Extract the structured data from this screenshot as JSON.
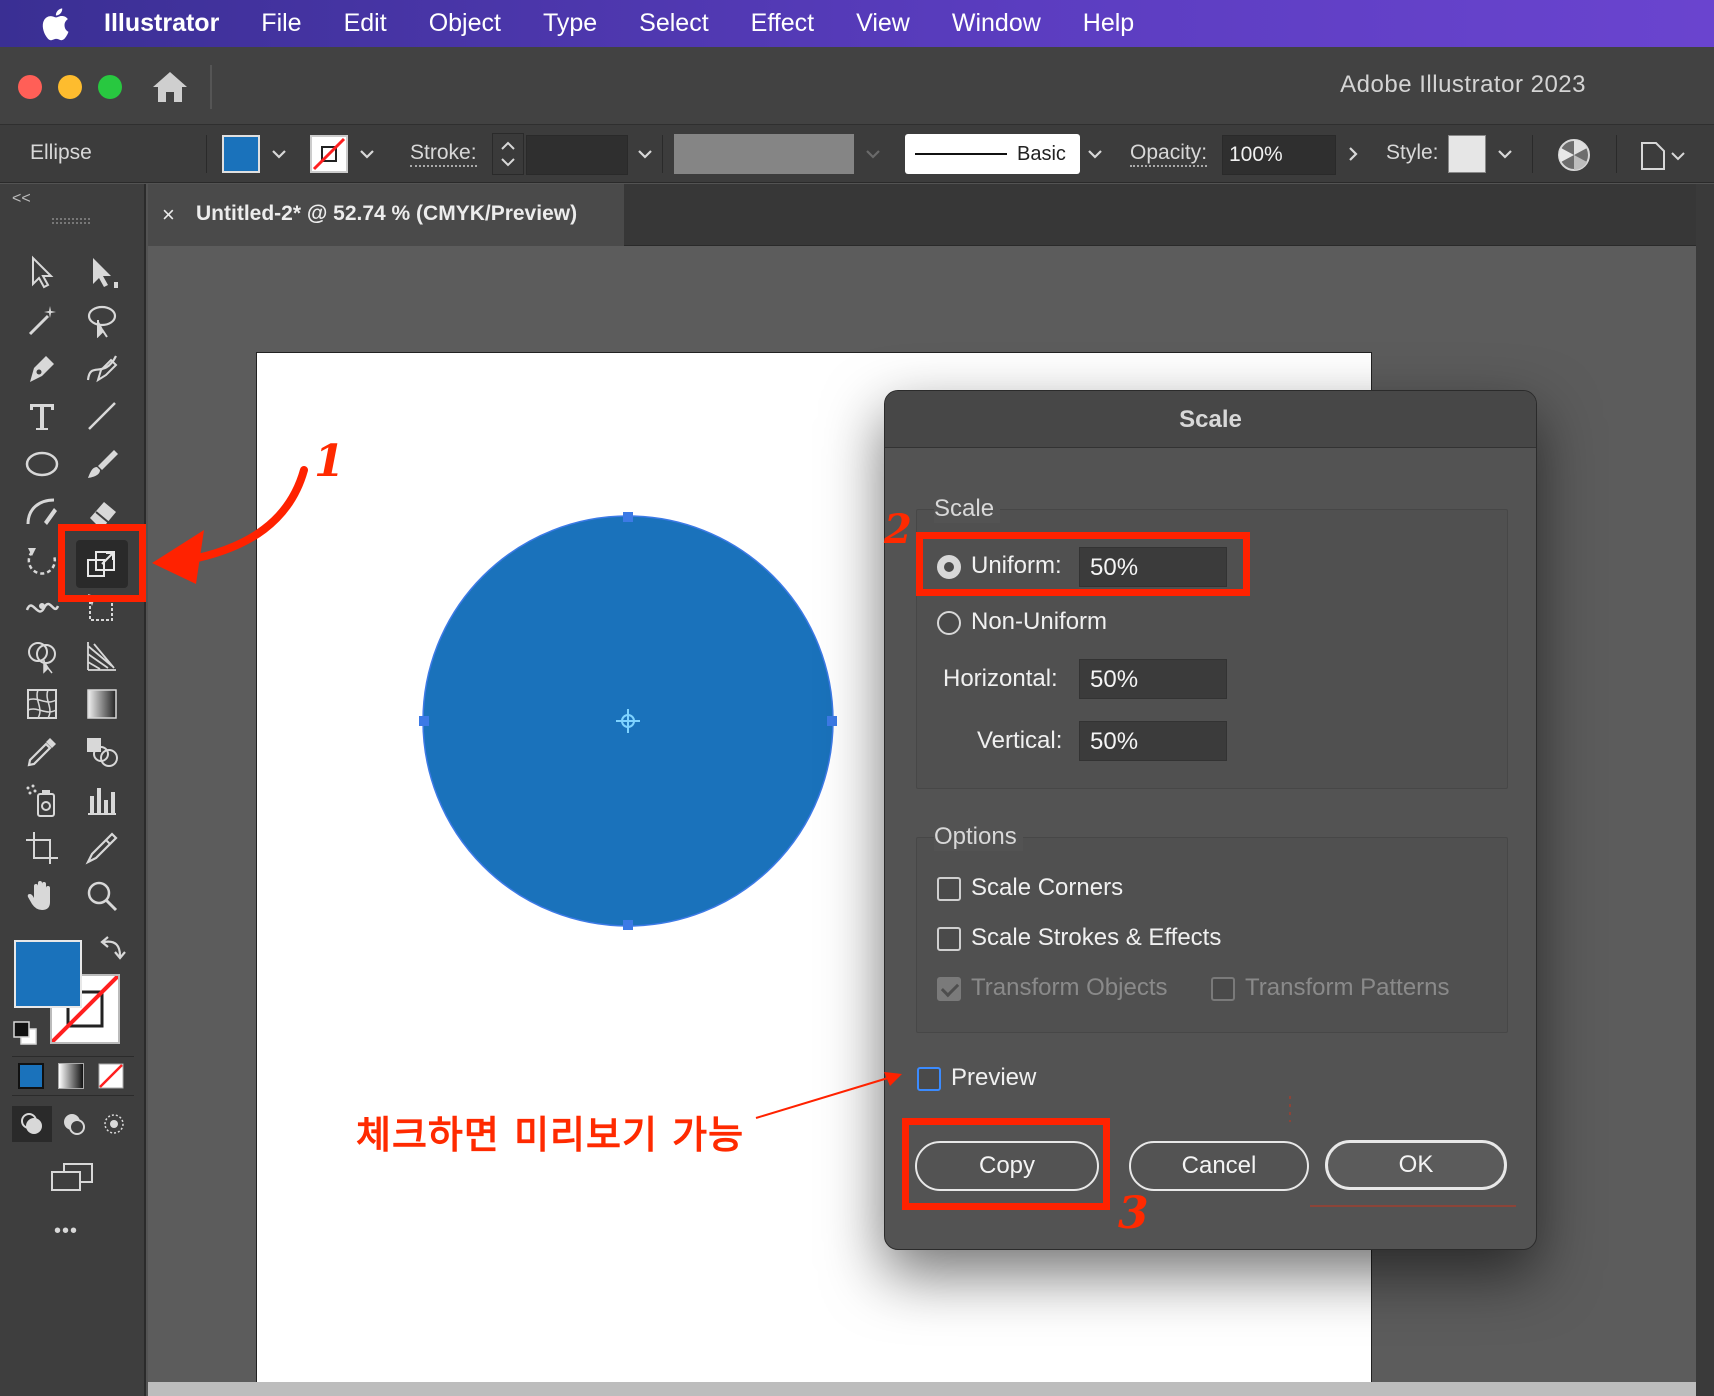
{
  "menubar": {
    "app_name": "Illustrator",
    "items": [
      "File",
      "Edit",
      "Object",
      "Type",
      "Select",
      "Effect",
      "View",
      "Window",
      "Help"
    ]
  },
  "window": {
    "title": "Adobe Illustrator 2023"
  },
  "control_bar": {
    "selection_type": "Ellipse",
    "fill_color": "#1a72bb",
    "stroke_label": "Stroke:",
    "brush_label": "Basic",
    "opacity_label": "Opacity:",
    "opacity_value": "100%",
    "style_label": "Style:"
  },
  "document_tab": {
    "close_glyph": "×",
    "title": "Untitled-2* @ 52.74 % (CMYK/Preview)"
  },
  "toolbar": {
    "collapse_glyph": "<<",
    "more_glyph": "•••",
    "fill_color": "#1a72bb"
  },
  "scale_dialog": {
    "title": "Scale",
    "scale_group": {
      "legend": "Scale",
      "uniform_label": "Uniform:",
      "uniform_value": "50%",
      "uniform_selected": true,
      "non_uniform_label": "Non-Uniform",
      "horizontal_label": "Horizontal:",
      "horizontal_value": "50%",
      "vertical_label": "Vertical:",
      "vertical_value": "50%"
    },
    "options_group": {
      "legend": "Options",
      "scale_corners_label": "Scale Corners",
      "scale_corners_checked": false,
      "scale_strokes_label": "Scale Strokes & Effects",
      "scale_strokes_checked": false,
      "transform_objects_label": "Transform Objects",
      "transform_objects_checked": true,
      "transform_patterns_label": "Transform Patterns",
      "transform_patterns_checked": false
    },
    "preview_label": "Preview",
    "preview_checked": false,
    "buttons": {
      "copy": "Copy",
      "cancel": "Cancel",
      "ok": "OK"
    }
  },
  "annotations": {
    "step1": "1",
    "step2": "2",
    "step3": "3",
    "preview_note": "체크하면 미리보기 가능",
    "color": "#ff2200"
  },
  "artwork": {
    "circle_color": "#1a72bb"
  }
}
